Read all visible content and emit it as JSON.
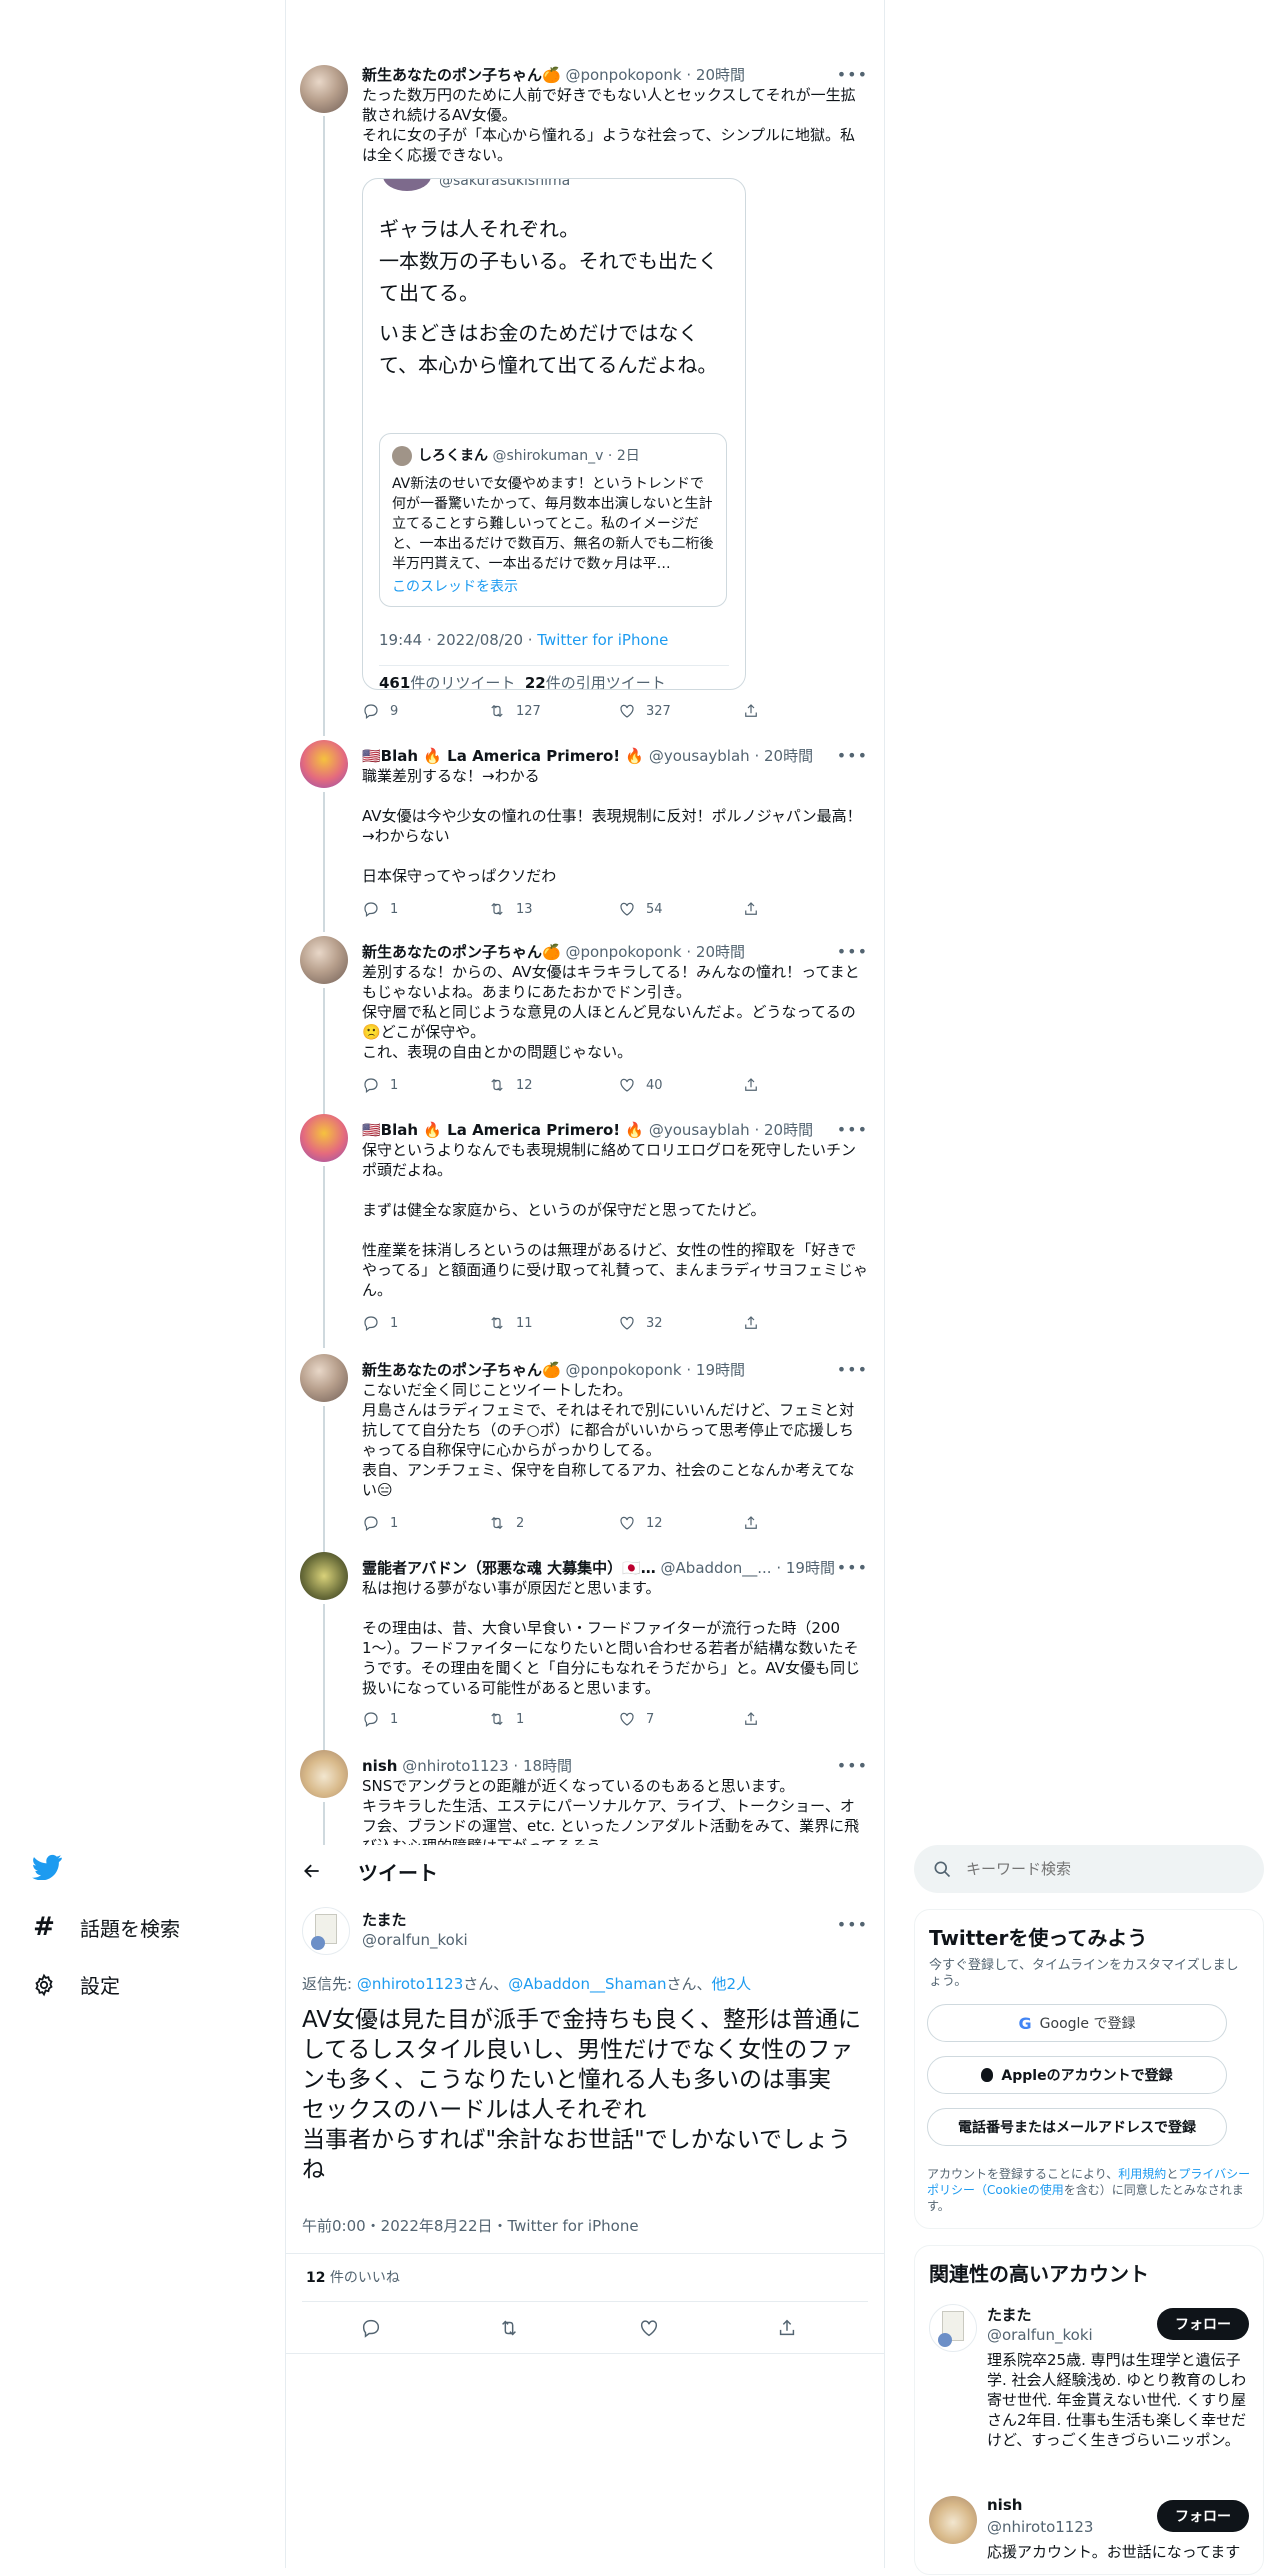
{
  "thread": [
    {
      "name": "新生あなたのポン子ちゃん🍊",
      "handle": "@ponpokoponk",
      "time": "20時間",
      "text": "たった数万円のために人前で好きでもない人とセックスしてそれが一生拡散され続けるAV女優。\nそれに女の子が「本心から憧れる」ような社会って、シンプルに地獄。私は全く応援できない。",
      "quote": {
        "partial_handle": "@sakurasukishima",
        "text1": "ギャラは人それぞれ。\n一本数万の子もいる。それでも出たくて出てる。",
        "text2": "いまどきはお金のためだけではなくて、本心から憧れて出てるんだよね。",
        "nested": {
          "name": "しろくまん",
          "handle": "@shirokuman_v",
          "time": "2日",
          "text": "AV新法のせいで女優やめます！というトレンドで何が一番驚いたかって、毎月数本出演しないと生計立てることすら難しいってとこ。私のイメージだと、一本出るだけで数百万、無名の新人でも二桁後半万円貰えて、一本出るだけで数ヶ月は平…",
          "show_thread": "このスレッドを表示"
        },
        "timestamp": "19:44 · 2022/08/20 · ",
        "client": "Twitter for iPhone",
        "retweets_n": "461",
        "retweets_label": "件のリツイート",
        "quotes_n": "22",
        "quotes_label": "件の引用ツイート"
      },
      "replies": "9",
      "retweets": "127",
      "likes": "327"
    },
    {
      "name": "🇺🇸Blah 🔥 La America Primero! 🔥",
      "handle": "@yousayblah",
      "time": "20時間",
      "text": "職業差別するな！→わかる\n\nAV女優は今や少女の憧れの仕事！表現規制に反対！ポルノジャパン最高！→わからない\n\n日本保守ってやっぱクソだわ",
      "replies": "1",
      "retweets": "13",
      "likes": "54"
    },
    {
      "name": "新生あなたのポン子ちゃん🍊",
      "handle": "@ponpokoponk",
      "time": "20時間",
      "text": "差別するな！からの、AV女優はキラキラしてる！みんなの憧れ！ってまともじゃないよね。あまりにあたおかでドン引き。\n保守層で私と同じような意見の人ほとんど見ないんだよ。どうなってるの🙁どこが保守や。\nこれ、表現の自由とかの問題じゃない。",
      "replies": "1",
      "retweets": "12",
      "likes": "40"
    },
    {
      "name": "🇺🇸Blah 🔥 La America Primero! 🔥",
      "handle": "@yousayblah",
      "time": "20時間",
      "text": "保守というよりなんでも表現規制に絡めてロリエログロを死守したいチンポ頭だよね。\n\nまずは健全な家庭から、というのが保守だと思ってたけど。\n\n性産業を抹消しろというのは無理があるけど、女性の性的搾取を「好きでやってる」と額面通りに受け取って礼賛って、まんまラディサヨフェミじゃん。",
      "replies": "1",
      "retweets": "11",
      "likes": "32"
    },
    {
      "name": "新生あなたのポン子ちゃん🍊",
      "handle": "@ponpokoponk",
      "time": "19時間",
      "text": "こないだ全く同じことツイートしたわ。\n月島さんはラディフェミで、それはそれで別にいいんだけど、フェミと対抗してて自分たち（のチ○ポ）に都合がいいからって思考停止で応援しちゃってる自称保守に心からがっかりしてる。\n表自、アンチフェミ、保守を自称してるアカ、社会のことなんか考えてない😑",
      "replies": "1",
      "retweets": "2",
      "likes": "12"
    },
    {
      "name": "霊能者アバドン（邪悪な魂 大募集中）🇯🇵…",
      "handle": "@Abaddon__...",
      "time": "19時間",
      "text": "私は抱ける夢がない事が原因だと思います。\n\nその理由は、昔、大食い早食い・フードファイターが流行った時（2001〜）。フードファイターになりたいと問い合わせる若者が結構な数いたそうです。その理由を聞くと「自分にもなれそうだから」と。AV女優も同じ扱いになっている可能性があると思います。",
      "replies": "1",
      "retweets": "1",
      "likes": "7"
    },
    {
      "name": "nish",
      "handle": "@nhiroto1123",
      "time": "18時間",
      "text": "SNSでアングラとの距離が近くなっているのもあると思います。\nキラキラした生活、エステにパーソナルケア、ライブ、トークショー、オフ会、ブランドの運営、etc. といったノンアダルト活動をみて、業界に飛び込む心理的障壁は下がってるそう"
    }
  ],
  "nav": {
    "explore": "話題を検索",
    "settings": "設定"
  },
  "main": {
    "header_title": "ツイート",
    "author_name": "たまた",
    "author_handle": "@oralfun_koki",
    "reply_prefix": "返信先: ",
    "reply_to_1": "@nhiroto1123",
    "san1": "さん、",
    "reply_to_2": "@Abaddon__Shaman",
    "san2": "さん、",
    "others": "他2人",
    "text": "AV女優は見た目が派手で金持ちも良く、整形は普通にしてるしスタイル良いし、男性だけでなく女性のファンも多く、こうなりたいと憧れる人も多いのは事実\nセックスのハードルは人それぞれ\n当事者からすれば\"余計なお世話\"でしかないでしょうね",
    "timestamp": "午前0:00・2022年8月22日・Twitter for iPhone",
    "likes_n": "12",
    "likes_label": " 件のいいね"
  },
  "right": {
    "search_placeholder": "キーワード検索",
    "signup_title": "Twitterを使ってみよう",
    "signup_sub": "今すぐ登録して、タイムラインをカスタマイズしましょう。",
    "google_btn": "Google で登録",
    "apple_btn": "Appleのアカウントで登録",
    "phone_btn": "電話番号またはメールアドレスで登録",
    "terms_1": "アカウントを登録することにより、",
    "terms_link1": "利用規約",
    "terms_2": "と",
    "terms_link2": "プライバシーポリシー（Cookieの使用",
    "terms_3": "を含む）に同意したとみなされます。",
    "related_title": "関連性の高いアカウント",
    "accounts": [
      {
        "name": "たまた",
        "handle": "@oralfun_koki",
        "follow": "フォロー",
        "bio": "理系院卒25歳. 専門は生理学と遺伝子学. 社会人経験浅め. ゆとり教育のしわ寄せ世代. 年金貰えない世代. くすり屋さん2年目. 仕事も生活も楽しく幸せだけど、すっごく生きづらいニッポン。"
      },
      {
        "name": "nish",
        "handle": "@nhiroto1123",
        "follow": "フォロー",
        "bio": "応援アカウント。お世話になってます"
      }
    ]
  },
  "colors": {
    "accent": "#1d9bf0",
    "text": "#0f1419",
    "muted": "#536471",
    "border": "#cfd9de"
  },
  "icons": [
    "twitter-bird-icon",
    "hashtag-icon",
    "gear-icon",
    "back-arrow-icon",
    "search-icon",
    "reply-icon",
    "retweet-icon",
    "like-icon",
    "share-icon",
    "more-icon",
    "google-icon",
    "apple-icon"
  ]
}
